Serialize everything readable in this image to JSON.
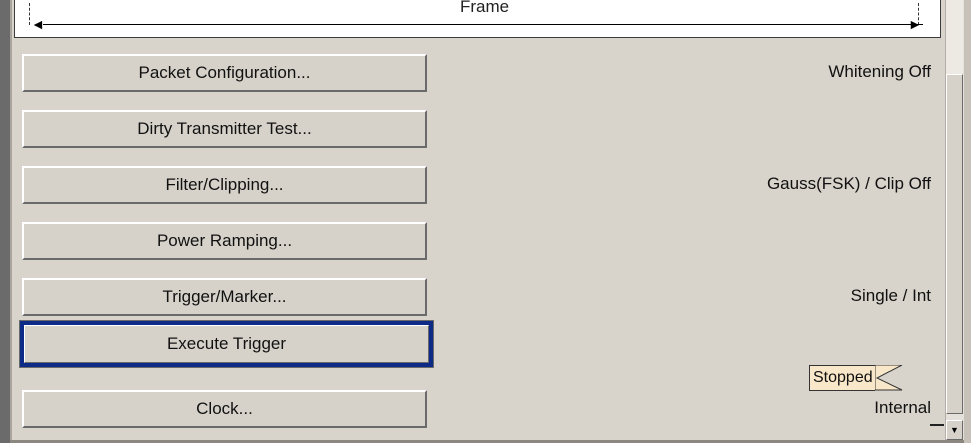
{
  "frame": {
    "label": "Frame"
  },
  "buttons": [
    {
      "label": "Packet Configuration...",
      "status": "Whitening Off"
    },
    {
      "label": "Dirty Transmitter Test...",
      "status": ""
    },
    {
      "label": "Filter/Clipping...",
      "status": "Gauss(FSK) / Clip Off"
    },
    {
      "label": "Power Ramping...",
      "status": ""
    },
    {
      "label": "Trigger/Marker...",
      "status": "Single / Int"
    },
    {
      "label": "Execute Trigger",
      "status": "Stopped"
    },
    {
      "label": "Clock...",
      "status": "Internal"
    }
  ],
  "icons": {
    "scroll_down": "scroll-down-arrow-icon",
    "frame_arrow_left": "arrow-left-icon",
    "frame_arrow_right": "arrow-right-icon"
  },
  "colors": {
    "focus_border": "#0d2a86",
    "stopped_badge": "#f8e7c8",
    "panel_bg": "#d8d3cb"
  }
}
